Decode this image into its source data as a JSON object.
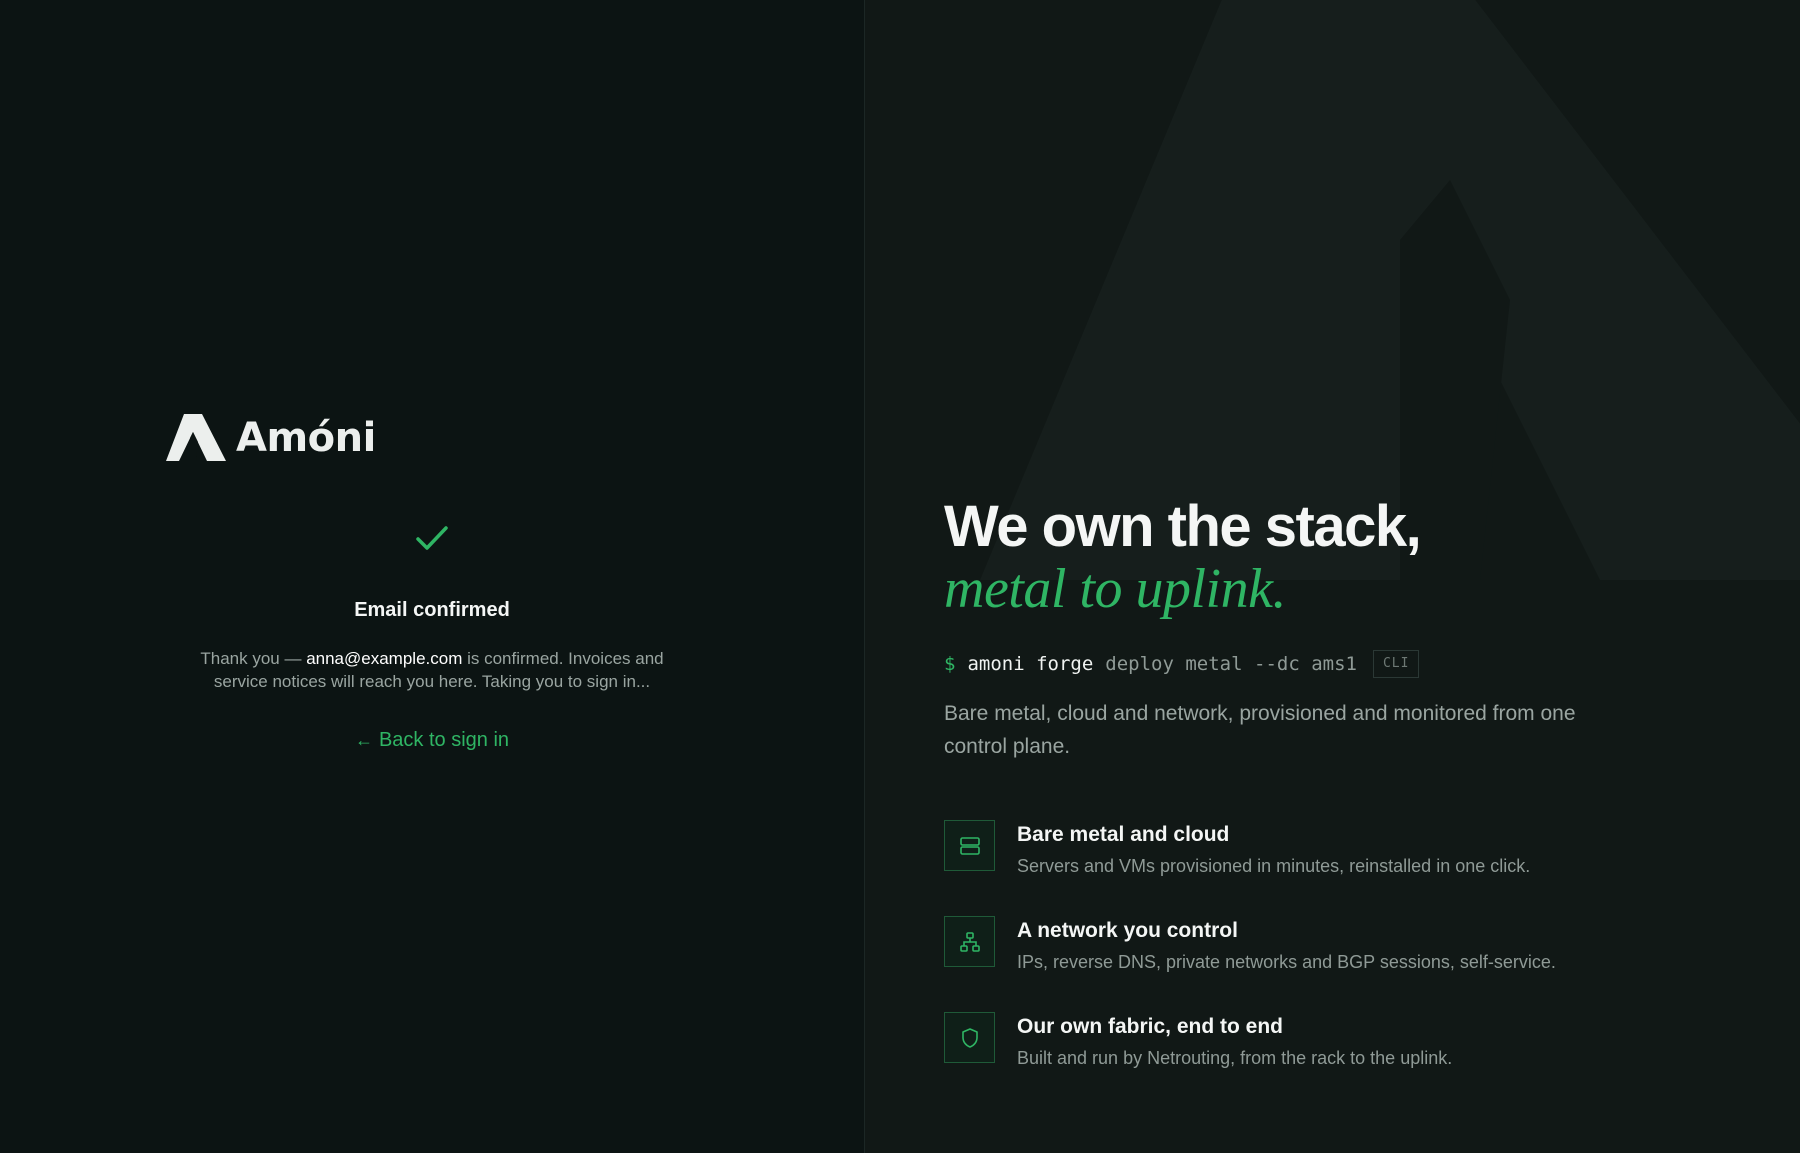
{
  "brand": {
    "name": "Amóni"
  },
  "confirm": {
    "icon": "check-icon",
    "title": "Email confirmed",
    "text_before": "Thank you — ",
    "email": "anna@example.com",
    "text_after": " is confirmed. Invoices and service notices will reach you here. Taking you to sign in...",
    "back_arrow": "←",
    "back_label": "Back to sign in"
  },
  "hero": {
    "heading_line1": "We own the stack,",
    "heading_line2": "metal to uplink.",
    "cli_prompt": "$",
    "cli_command": "amoni forge",
    "cli_args": "deploy metal --dc ams1",
    "cli_badge": "CLI",
    "subtitle": "Bare metal, cloud and network, provisioned and monitored from one control plane."
  },
  "features": [
    {
      "icon": "server-icon",
      "title": "Bare metal and cloud",
      "desc": "Servers and VMs provisioned in minutes, reinstalled in one click."
    },
    {
      "icon": "network-icon",
      "title": "A network you control",
      "desc": "IPs, reverse DNS, private networks and BGP sessions, self-service."
    },
    {
      "icon": "shield-icon",
      "title": "Our own fabric, end to end",
      "desc": "Built and run by Netrouting, from the rack to the uplink."
    }
  ],
  "colors": {
    "accent": "#2fb564",
    "background": "#0c1413",
    "panel": "#111816",
    "muted": "#9aa5a1"
  }
}
